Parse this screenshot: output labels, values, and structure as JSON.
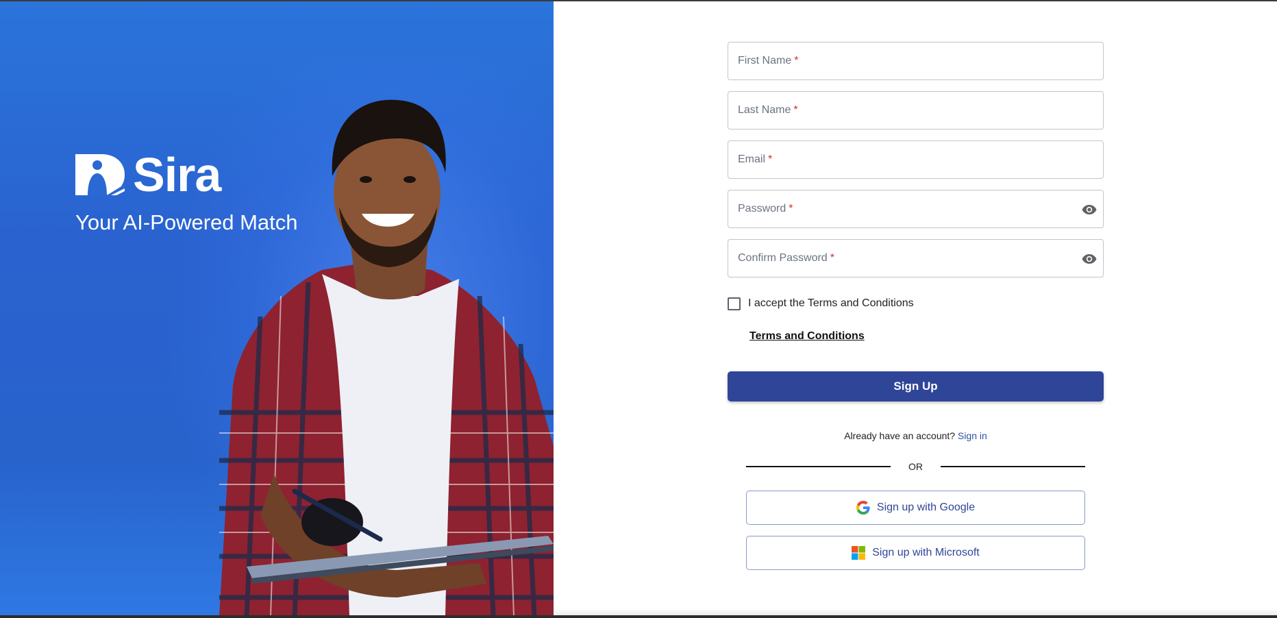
{
  "brand": {
    "name": "Sira",
    "tagline": "Your AI-Powered Match"
  },
  "form": {
    "fields": [
      {
        "label": "First Name",
        "required_mark": "*"
      },
      {
        "label": "Last Name",
        "required_mark": "*"
      },
      {
        "label": "Email",
        "required_mark": "*"
      },
      {
        "label": "Password",
        "required_mark": "*"
      },
      {
        "label": "Confirm Password",
        "required_mark": "*"
      }
    ],
    "terms_checkbox_label": "I accept the Terms and Conditions",
    "terms_checkbox_checked": false,
    "terms_link": "Terms and Conditions",
    "submit_label": "Sign Up",
    "account_prompt": "Already have an account?",
    "signin_link": "Sign in",
    "divider_text": "OR",
    "google_button": "Sign up with Google",
    "microsoft_button": "Sign up with Microsoft"
  },
  "colors": {
    "hero_blue": "#2a66d3",
    "primary_button": "#2f4597",
    "required": "#d32f2f",
    "link": "#2f4fa8"
  },
  "icons": {
    "password_toggle": "eye-icon",
    "google": "google-g-icon",
    "microsoft": "microsoft-logo-icon"
  }
}
